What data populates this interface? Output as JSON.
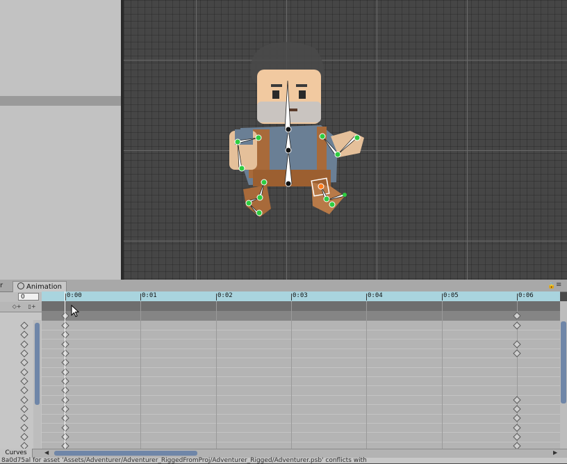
{
  "animation_window": {
    "tab_partial": "r",
    "tab_label": "Animation",
    "frame_value": "0",
    "ruler_labels": [
      "0:00",
      "0:01",
      "0:02",
      "0:03",
      "0:04",
      "0:05",
      "0:06"
    ],
    "add_key_glyph": "◇+",
    "add_event_glyph": "▯+",
    "curves_label": "Curves",
    "lock_glyph": "🔒",
    "menu_glyph": "≡"
  },
  "console": {
    "message": "8a0d75al for asset 'Assets/Adventurer/Adventurer_RiggedFromProj/Adventurer_Rigged/Adventurer.psb' conflicts with"
  },
  "colors": {
    "bone": "#ffffff",
    "joint": "#2ecc40",
    "ruler": "#a9d4de",
    "scrollbar": "#6f86a8"
  },
  "icons": [
    "clock-icon",
    "lock-icon",
    "menu-icon",
    "key-diamond-icon",
    "mouse-cursor-icon"
  ]
}
